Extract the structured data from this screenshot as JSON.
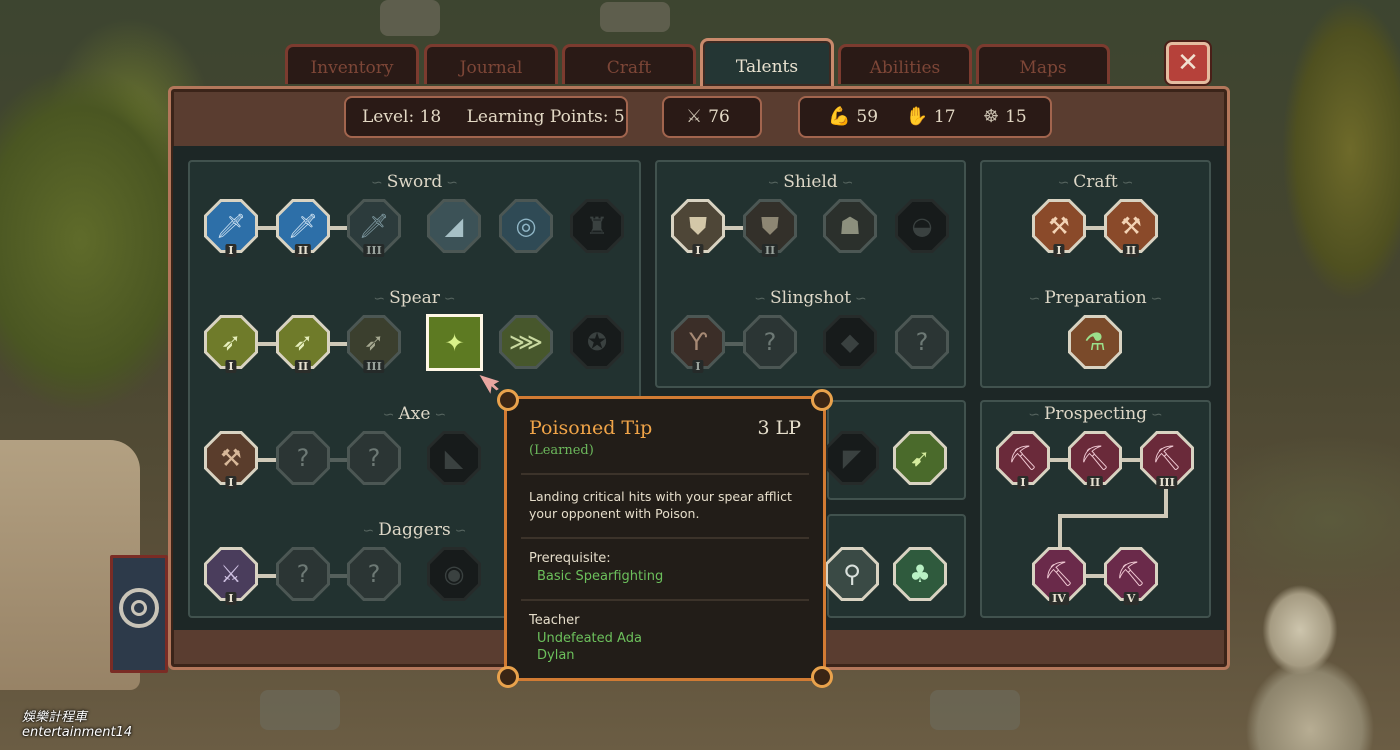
{
  "tabs": [
    "Inventory",
    "Journal",
    "Craft",
    "Talents",
    "Abilities",
    "Maps"
  ],
  "active_tab": "Talents",
  "close_glyph": "✕",
  "stats": {
    "level_text": "Level: 18",
    "learning_points_text": "Learning Points: 5",
    "attack": "76",
    "strength": "59",
    "agility": "17",
    "intelligence": "15"
  },
  "icons": {
    "attack": "crossed-swords-icon",
    "strength": "arm-icon",
    "agility": "hand-icon",
    "intelligence": "brain-icon"
  },
  "sections": {
    "sword": "Sword",
    "spear": "Spear",
    "axe": "Axe",
    "daggers": "Daggers",
    "shield": "Shield",
    "slingshot": "Slingshot",
    "craft": "Craft",
    "preparation": "Preparation",
    "prospecting": "Prospecting"
  },
  "ranks": {
    "i": "I",
    "ii": "II",
    "iii": "III",
    "iv": "IV",
    "v": "V"
  },
  "tooltip": {
    "title": "Poisoned Tip",
    "cost": "3 LP",
    "status": "(Learned)",
    "description": "Landing critical hits with your spear afflict your opponent with Poison.",
    "prerequisite_label": "Prerequisite:",
    "prerequisite": "Basic Spearfighting",
    "teacher_label": "Teacher",
    "teachers": [
      "Undefeated Ada",
      "Dylan"
    ]
  },
  "watermark": [
    "娛樂計程車",
    "entertainment14"
  ],
  "colors": {
    "accent_orange": "#f0a448",
    "learned_green": "#6cb85c",
    "frame_brown": "#5a3d30",
    "panel_teal": "#223230"
  }
}
